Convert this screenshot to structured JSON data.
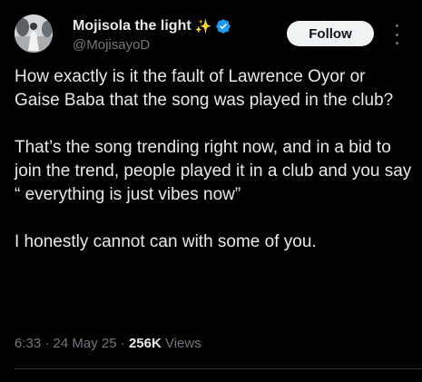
{
  "author": {
    "display_name": "Mojisola the light",
    "handle": "@MojisayoD",
    "verified": true,
    "emoji": "✨"
  },
  "actions": {
    "follow_label": "Follow"
  },
  "tweet": {
    "paragraphs": [
      "How exactly is it the fault of Lawrence Oyor or Gaise Baba that the song was played in the club?",
      "That’s the song trending right now, and in a bid to join the trend, people played it in a club and you say “ everything is just vibes now”",
      "I honestly cannot can with some of you."
    ],
    "time": "6:33",
    "date": "24 May 25",
    "separator": "·",
    "views_count": "256K",
    "views_label": "Views"
  },
  "colors": {
    "background": "#000000",
    "text": "#e7e9ea",
    "muted": "#71767b",
    "verified_blue": "#1d9bf0",
    "follow_bg": "#eff3f4"
  }
}
